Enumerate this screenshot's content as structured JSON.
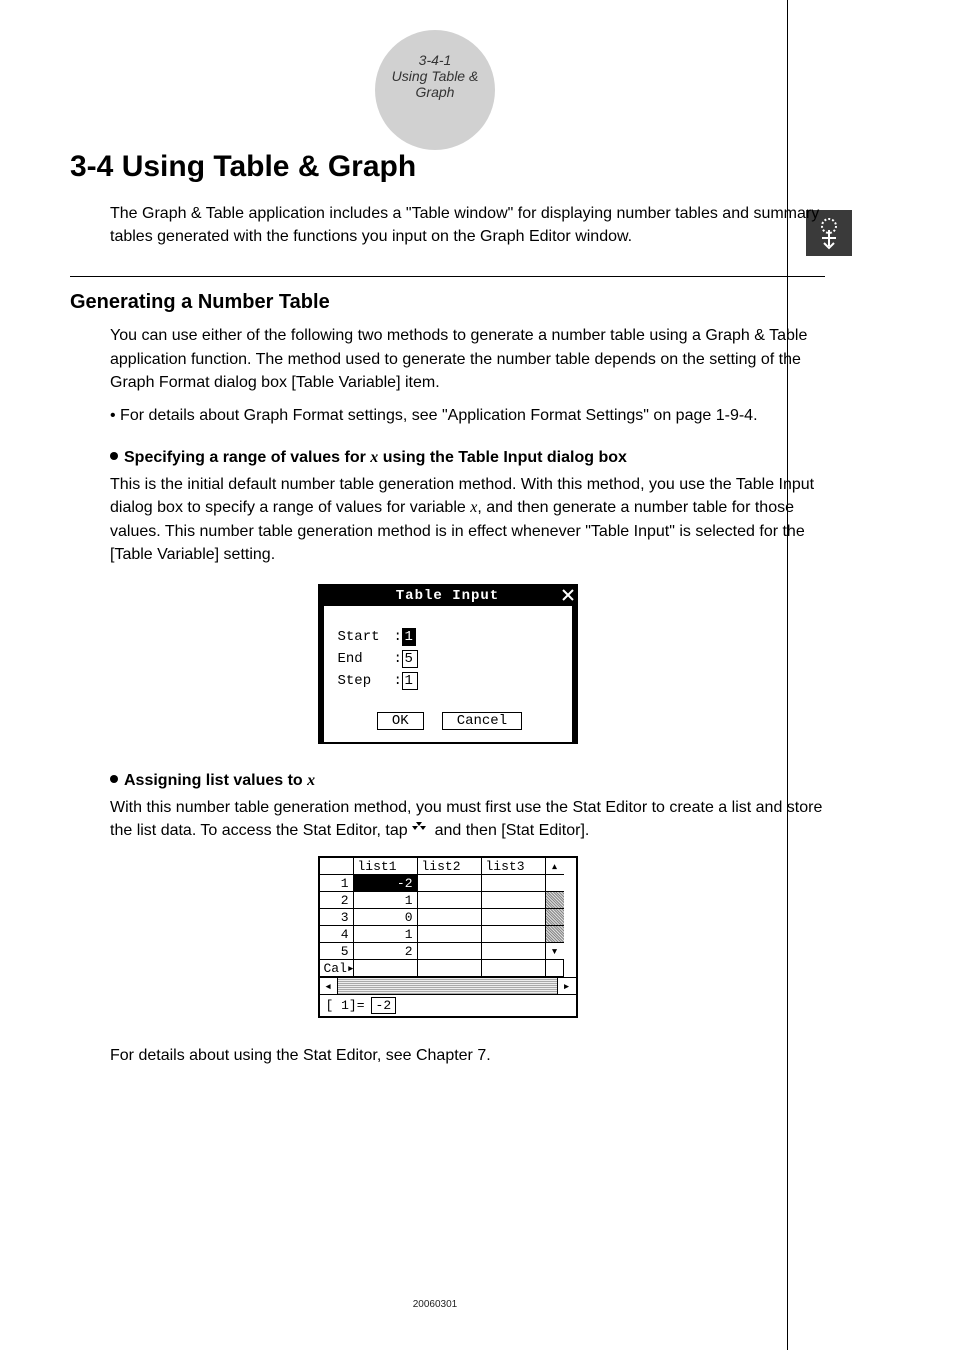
{
  "header": {
    "section_number": "3-4-1",
    "section_title": "Using Table & Graph"
  },
  "title": "3-4  Using Table & Graph",
  "intro": "The Graph & Table application includes a \"Table window\" for displaying number tables and summary tables generated with the functions you input on the Graph Editor window.",
  "subheading": "Generating a Number Table",
  "body1": "You can use either of the following two methods to generate a number table using a Graph & Table application function. The method used to generate the number table depends on the setting of the Graph Format dialog box [Table Variable] item.",
  "bullet1": "• For details about Graph Format settings, see \"Application Format Settings\" on page 1-9-4.",
  "dot1": {
    "prefix": "Specifying a range of values for ",
    "var": "x",
    "suffix": " using the Table Input dialog box"
  },
  "body2a": "This is the initial default number table generation method. With this method, you use the Table Input dialog box to specify a range of values for variable ",
  "body2var": "x",
  "body2b": ", and then generate a number table for those values. This number table generation method is in effect whenever \"Table Input\" is selected for the [Table Variable] setting.",
  "tableInput": {
    "title": "Table Input",
    "start_label": "Start",
    "end_label": "End",
    "step_label": "Step",
    "start_value": "1",
    "end_value": "5",
    "step_value": "1",
    "ok": "OK",
    "cancel": "Cancel"
  },
  "dot2": {
    "prefix": "Assigning list values to ",
    "var": "x"
  },
  "body3a": "With this number table generation method, you must first use the Stat Editor to create a list and store the list data. To access the Stat Editor, tap ",
  "body3b": " and then [Stat Editor].",
  "statEditor": {
    "headers": [
      "list1",
      "list2",
      "list3"
    ],
    "rows": [
      {
        "n": "1",
        "v1": "-2"
      },
      {
        "n": "2",
        "v1": "1"
      },
      {
        "n": "3",
        "v1": "0"
      },
      {
        "n": "4",
        "v1": "1"
      },
      {
        "n": "5",
        "v1": "2"
      }
    ],
    "cal_label": "Cal▸",
    "input_prefix": "[    1]=",
    "input_value": "-2"
  },
  "closing": "For details about using the Stat Editor, see Chapter 7.",
  "footer": "20060301"
}
